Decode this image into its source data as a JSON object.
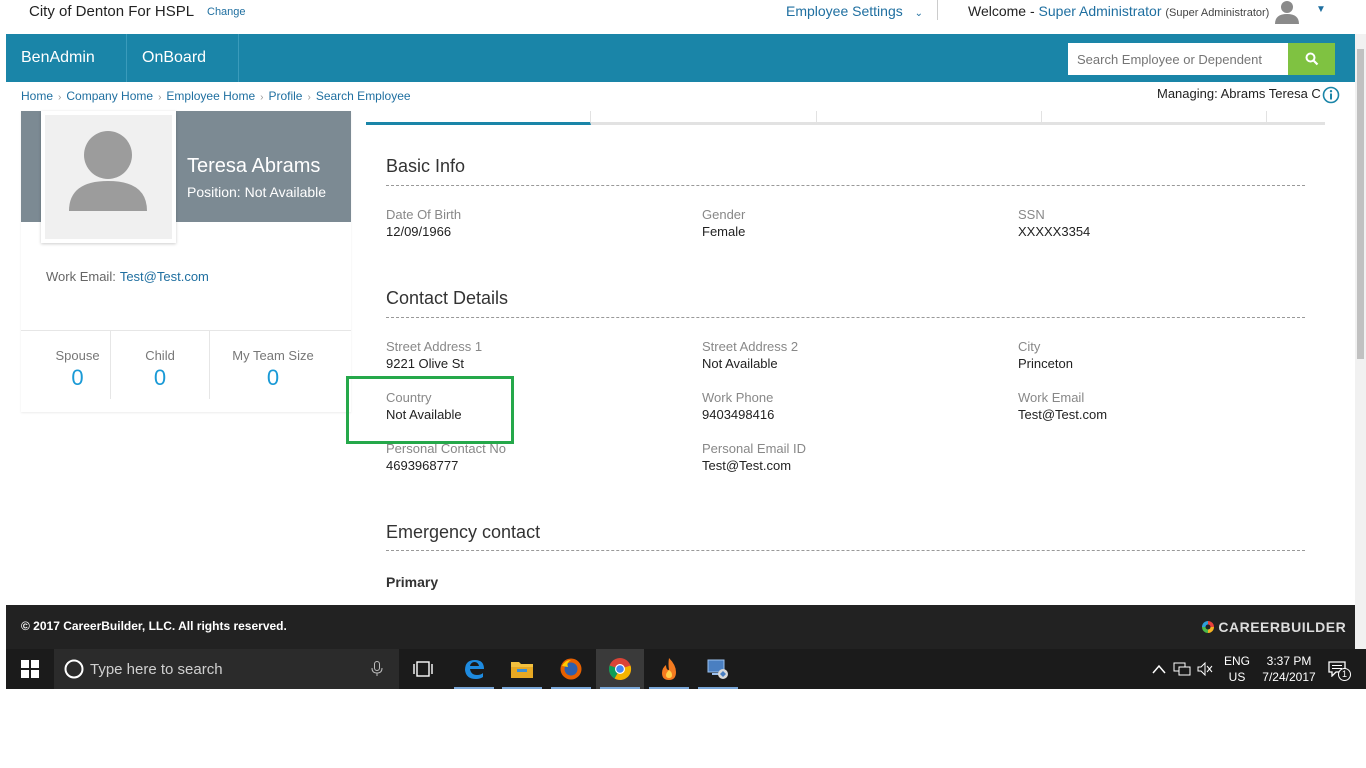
{
  "top": {
    "company": "City of Denton For HSPL",
    "change": "Change",
    "employee_settings": "Employee Settings",
    "welcome_prefix": "Welcome -",
    "user": "Super Administrator",
    "role": "(Super Administrator)"
  },
  "nav": {
    "items": [
      {
        "label": "BenAdmin"
      },
      {
        "label": "OnBoard"
      }
    ],
    "search_placeholder": "Search Employee or Dependent"
  },
  "breadcrumb": [
    "Home",
    "Company Home",
    "Employee Home",
    "Profile",
    "Search Employee"
  ],
  "managing": {
    "label": "Managing:",
    "value": "Abrams Teresa C"
  },
  "profile": {
    "name": "Teresa Abrams",
    "position_label": "Position:",
    "position_value": "Not Available",
    "work_email_label": "Work Email:",
    "work_email_value": "Test@Test.com",
    "counts": [
      {
        "label": "Spouse",
        "value": "0"
      },
      {
        "label": "Child",
        "value": "0"
      },
      {
        "label": "My Team Size",
        "value": "0"
      }
    ]
  },
  "basic_info": {
    "title": "Basic Info",
    "fields": [
      {
        "label": "Date Of Birth",
        "value": "12/09/1966"
      },
      {
        "label": "Gender",
        "value": "Female"
      },
      {
        "label": "SSN",
        "value": "XXXXX3354"
      }
    ]
  },
  "contact": {
    "title": "Contact Details",
    "fields": [
      {
        "label": "Street Address 1",
        "value": "9221 Olive St"
      },
      {
        "label": "Street Address 2",
        "value": "Not Available"
      },
      {
        "label": "City",
        "value": "Princeton"
      },
      {
        "label": "Country",
        "value": "Not Available"
      },
      {
        "label": "Work Phone",
        "value": "9403498416"
      },
      {
        "label": "Work Email",
        "value": "Test@Test.com"
      },
      {
        "label": "Personal Contact No",
        "value": "4693968777"
      },
      {
        "label": "Personal Email ID",
        "value": "Test@Test.com"
      }
    ]
  },
  "emergency": {
    "title": "Emergency contact",
    "primary": "Primary"
  },
  "footer": {
    "copyright": "© 2017 CareerBuilder, LLC. All rights reserved.",
    "brand": "CAREERBUILDER"
  },
  "taskbar": {
    "search_placeholder": "Type here to search",
    "lang1": "ENG",
    "lang2": "US",
    "time": "3:37 PM",
    "date": "7/24/2017",
    "notification_count": "1"
  },
  "icons": {
    "search": "search-icon",
    "info": "info-icon",
    "avatar": "avatar-icon",
    "windows": "windows-icon",
    "mic": "mic-icon",
    "task_view": "task-view-icon",
    "edge": "edge-icon",
    "explorer": "file-explorer-icon",
    "firefox": "firefox-icon",
    "chrome": "chrome-icon",
    "app": "flame-app-icon",
    "network_app": "network-app-icon",
    "notification": "notification-icon"
  },
  "colors": {
    "nav": "#1a85a8",
    "search_button": "#7fc241",
    "highlight": "#25a84a",
    "link": "#1f6fa0",
    "count": "#1a9ad6"
  }
}
